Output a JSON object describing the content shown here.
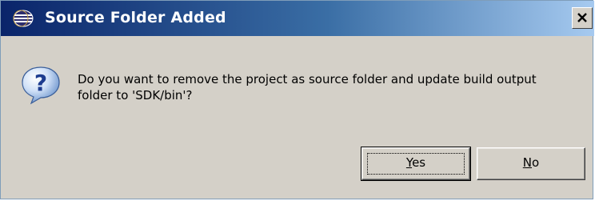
{
  "window": {
    "title": "Source Folder Added",
    "title_icon": "eclipse-icon",
    "close_label": "×"
  },
  "message": {
    "icon": "question-icon",
    "line1": "Do you want to remove the project as source folder and update build output",
    "line2": "folder to 'SDK/bin'?"
  },
  "buttons": {
    "yes": {
      "label": "Yes",
      "mnemonic": "Y",
      "rest": "es"
    },
    "no": {
      "label": "No",
      "mnemonic": "N",
      "rest": "o"
    }
  },
  "colors": {
    "titlebar_start": "#0a246a",
    "titlebar_end": "#a6caf0",
    "dialog_bg": "#d4d0c8"
  }
}
